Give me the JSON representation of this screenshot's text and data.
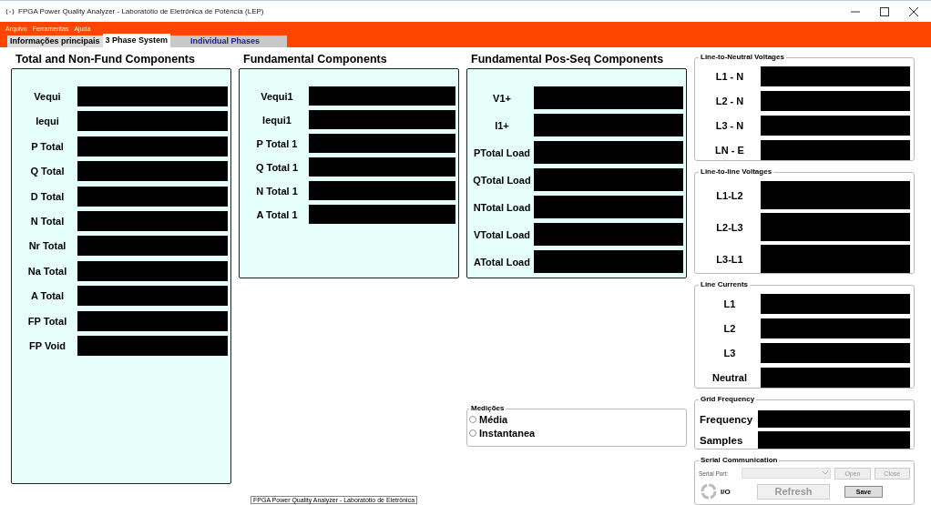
{
  "window": {
    "title": "FPGA Power Quality Analyzer - Laboratótio de Eletrônica de Potência (LEP)"
  },
  "menu": [
    "Arquivo",
    "Ferramentas",
    "Ajuda"
  ],
  "tabs": [
    {
      "label": "Informações principais",
      "selected": false
    },
    {
      "label": "3 Phase System",
      "selected": true
    },
    {
      "label": "Individual Phases",
      "selected": false
    }
  ],
  "panels": [
    {
      "title": "Total and Non-Fund Components",
      "kind": "tall",
      "labels": [
        "Vequi",
        "Iequi",
        "P Total",
        "Q Total",
        "D Total",
        "N Total",
        "Nr Total",
        "Na Total",
        "A Total",
        "FP Total",
        "FP Void"
      ]
    },
    {
      "title": "Fundamental Components",
      "kind": "short",
      "labels": [
        "Vequi1",
        "Iequi1",
        "P Total 1",
        "Q Total 1",
        "N Total 1",
        "A Total 1"
      ]
    },
    {
      "title": "Fundamental Pos-Seq Components",
      "kind": "wide",
      "labels": [
        "V1+",
        "I1+",
        "PTotal Load",
        "QTotal Load",
        "NTotal Load",
        "VTotal Load",
        "ATotal Load"
      ]
    }
  ],
  "measurements": {
    "title": "Medições",
    "options": [
      {
        "label": "Média",
        "selected": false
      },
      {
        "label": "Instantanea",
        "selected": false
      }
    ]
  },
  "groups": [
    {
      "title": "Line-to-Neutral Voltages",
      "kind": "normal",
      "labels": [
        "L1 - N",
        "L2 - N",
        "L3 - N",
        "LN - E"
      ]
    },
    {
      "title": "Line-to-line Voltages",
      "kind": "tall",
      "labels": [
        "L1-L2",
        "L2-L3",
        "L3-L1"
      ]
    },
    {
      "title": "Line Currents",
      "kind": "normal",
      "labels": [
        "L1",
        "L2",
        "L3",
        "Neutral"
      ]
    },
    {
      "title": "Grid Frequency",
      "kind": "compact",
      "labels": [
        "Frequency",
        "Samples"
      ]
    }
  ],
  "serial": {
    "title": "Serial Communication",
    "port_label": "Serial Port:",
    "open": {
      "label": "Open",
      "disabled": true
    },
    "close": {
      "label": "Close",
      "disabled": true
    },
    "io_label": "I/O",
    "refresh": {
      "label": "Refresh",
      "disabled": true
    },
    "save": {
      "label": "Save",
      "disabled": false
    }
  },
  "tooltip": "FPGA Power Quality Analyzer - Laboratótio de Eletrônica"
}
